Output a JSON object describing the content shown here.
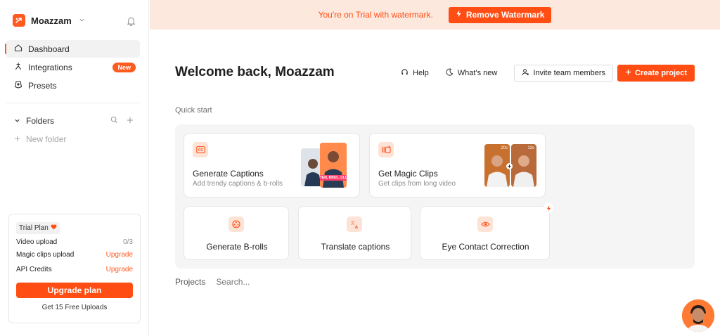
{
  "brand": {
    "name": "Moazzam"
  },
  "nav": {
    "items": [
      {
        "label": "Dashboard"
      },
      {
        "label": "Integrations",
        "badge": "New"
      },
      {
        "label": "Presets"
      }
    ]
  },
  "folders": {
    "label": "Folders",
    "new_folder": "New folder"
  },
  "trial": {
    "badge": "Trial Plan",
    "rows": [
      {
        "label": "Video upload",
        "value": "0/3"
      },
      {
        "label": "Magic clips upload",
        "value": "Upgrade"
      },
      {
        "label": "API Credits",
        "value": "Upgrade"
      }
    ],
    "upgrade_label": "Upgrade plan",
    "free_uploads": "Get 15 Free Uploads"
  },
  "banner": {
    "text": "You're on Trial with watermark.",
    "button": "Remove Watermark"
  },
  "header": {
    "welcome": "Welcome back, Moazzam",
    "help": "Help",
    "whats_new": "What's new",
    "invite": "Invite team members",
    "create": "Create project"
  },
  "quick_start": {
    "label": "Quick start",
    "cards": [
      {
        "title": "Generate Captions",
        "subtitle": "Add trendy captions & b-rolls",
        "thumb_text": "LISTEN, BRUL, CLUTS"
      },
      {
        "title": "Get Magic Clips",
        "subtitle": "Get clips from long video",
        "dur1": "20s",
        "dur2": "13s"
      },
      {
        "title": "Generate B-rolls"
      },
      {
        "title": "Translate captions"
      },
      {
        "title": "Eye Contact Correction"
      }
    ]
  },
  "projects": {
    "label": "Projects",
    "search_placeholder": "Search..."
  },
  "colors": {
    "accent": "#ff4d13",
    "banner_bg": "#fde8dd",
    "panel_bg": "#f5f5f5"
  }
}
